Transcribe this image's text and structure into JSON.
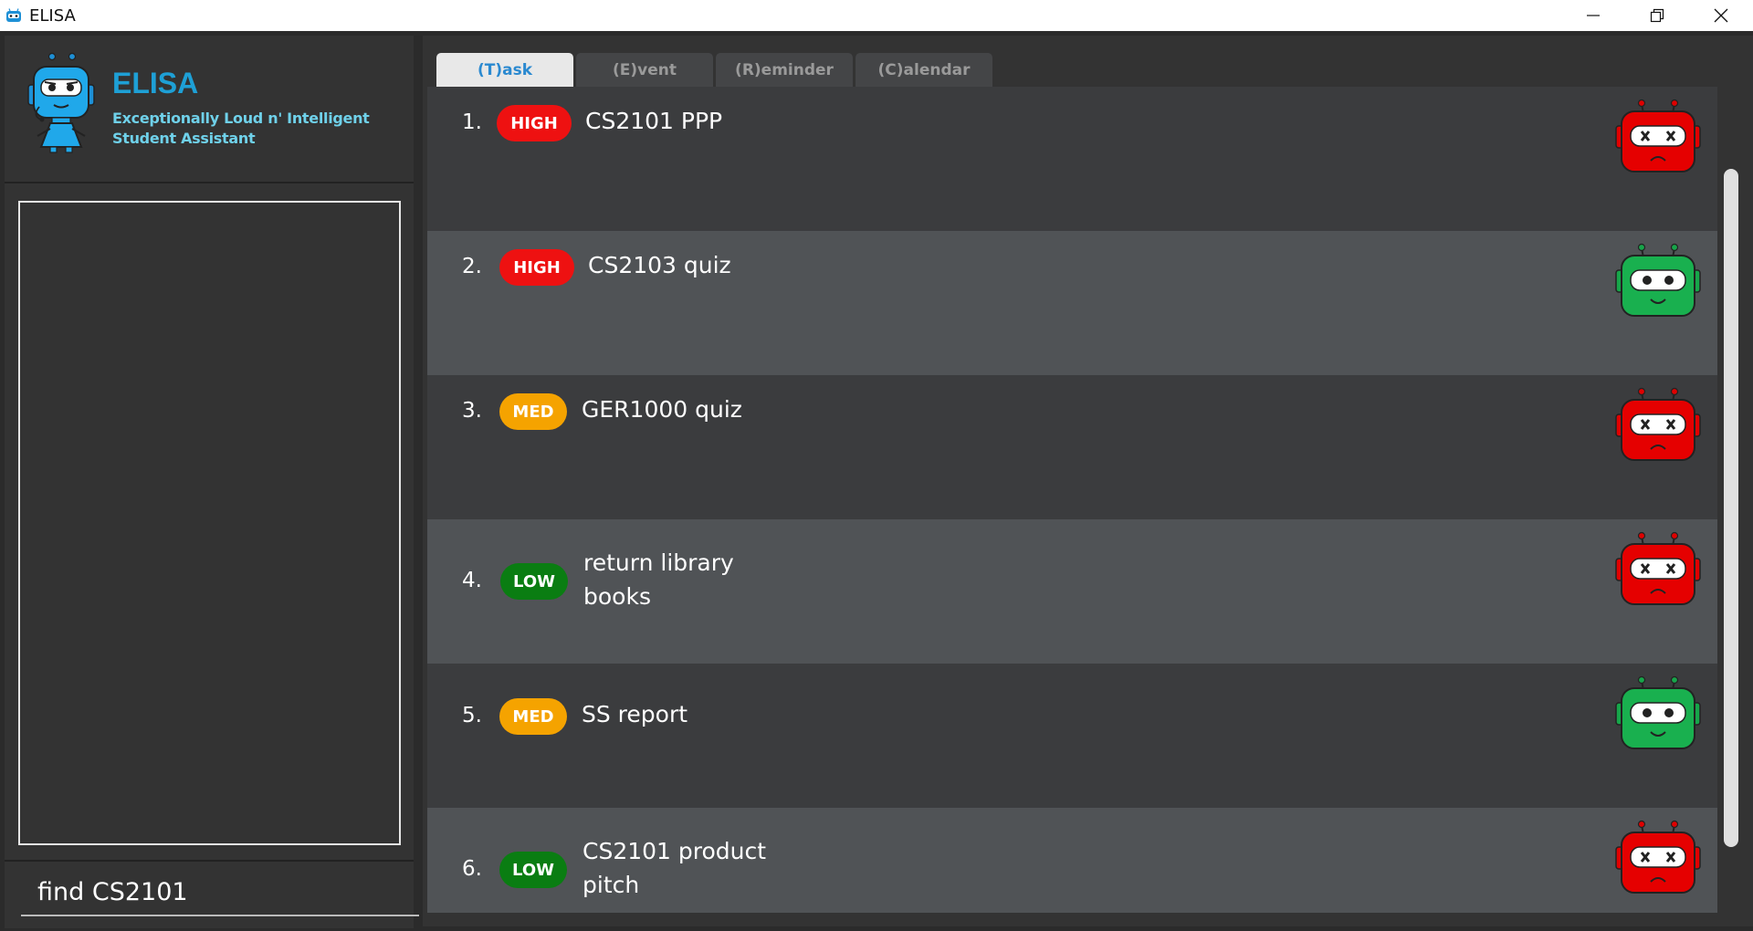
{
  "window": {
    "title": "ELISA"
  },
  "sidebar": {
    "app_name": "ELISA",
    "tagline_line1": "Exceptionally Loud n' Intelligent",
    "tagline_line2": "Student Assistant",
    "command_value": "find CS2101"
  },
  "tabs": [
    {
      "label": "(T)ask",
      "active": true
    },
    {
      "label": "(E)vent",
      "active": false
    },
    {
      "label": "(R)eminder",
      "active": false
    },
    {
      "label": "(C)alendar",
      "active": false
    }
  ],
  "tasks": [
    {
      "index": "1.",
      "priority": "HIGH",
      "lines": [
        "CS2101 PPP"
      ],
      "done": false
    },
    {
      "index": "2.",
      "priority": "HIGH",
      "lines": [
        "CS2103 quiz"
      ],
      "done": true
    },
    {
      "index": "3.",
      "priority": "MED",
      "lines": [
        "GER1000 quiz"
      ],
      "done": false
    },
    {
      "index": "4.",
      "priority": "LOW",
      "lines": [
        "return library",
        "books"
      ],
      "done": false
    },
    {
      "index": "5.",
      "priority": "MED",
      "lines": [
        "SS report"
      ],
      "done": true
    },
    {
      "index": "6.",
      "priority": "LOW",
      "lines": [
        "CS2101 product",
        "pitch"
      ],
      "done": false
    }
  ],
  "colors": {
    "high": "#ee1111",
    "med": "#f5a300",
    "low": "#0a7d12",
    "brand": "#1ea0d6",
    "active_tab_text": "#2a89d0"
  },
  "icons": {
    "done": "happy-robot-icon",
    "not_done": "sad-robot-icon"
  }
}
